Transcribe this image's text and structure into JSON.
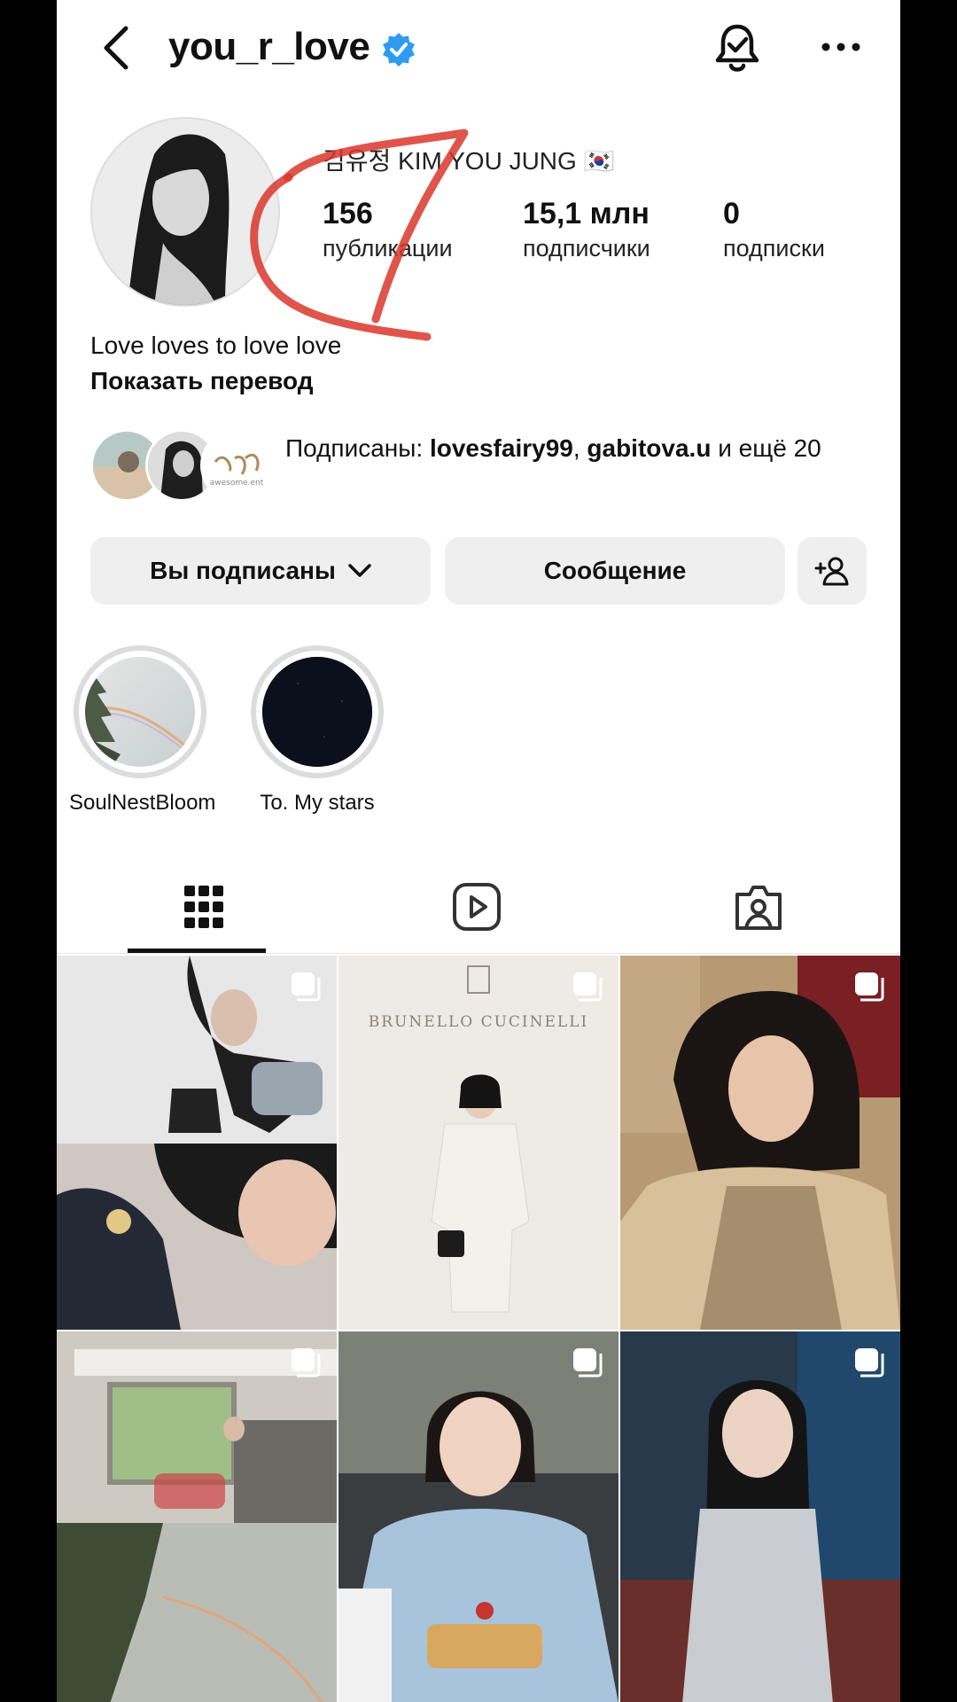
{
  "header": {
    "username": "you_r_love"
  },
  "profile": {
    "full_name": "김유정  KIM YOU JUNG 🇰🇷",
    "stats": [
      {
        "value": "156",
        "label": "публикации"
      },
      {
        "value": "15,1 млн",
        "label": "подписчики"
      },
      {
        "value": "0",
        "label": "подписки"
      }
    ],
    "bio": "Love loves to love love",
    "show_translation": "Показать перевод",
    "followed_by": {
      "prefix": "Подписаны: ",
      "user1": "lovesfairy99",
      "sep": ", ",
      "user2": "gabitova.u",
      "suffix": " и ещё 20"
    },
    "mutual_avatar_text": "awesome.ent"
  },
  "buttons": {
    "following": "Вы подписаны",
    "message": "Сообщение"
  },
  "highlights": [
    {
      "label": "SoulNestBloom"
    },
    {
      "label": "To. My stars"
    }
  ],
  "tabs": [
    "grid-icon",
    "reels-icon",
    "tagged-icon"
  ],
  "posts_grid_image_text": "BRUNELLO CUCINELLI",
  "colors": {
    "verified": "#2f9bf0",
    "scribble": "#d9372b"
  }
}
